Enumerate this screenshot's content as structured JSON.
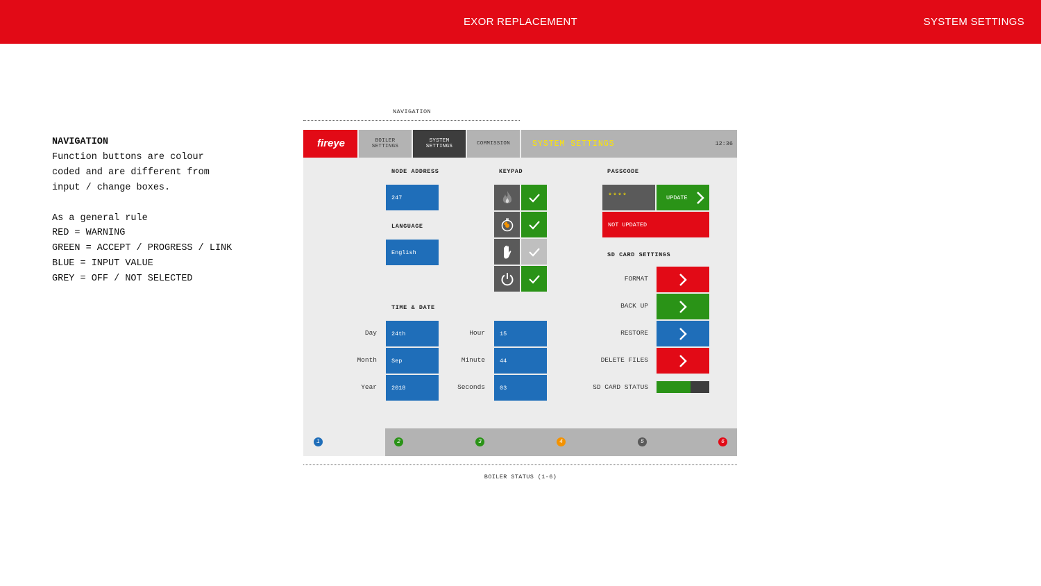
{
  "header": {
    "title": "EXOR REPLACEMENT",
    "section": "SYSTEM SETTINGS"
  },
  "notes": {
    "heading": "NAVIGATION",
    "lines": [
      "Function buttons are colour",
      "coded and are different from",
      "input / change boxes.",
      "",
      "As a general rule",
      "RED = WARNING",
      "GREEN = ACCEPT / PROGRESS / LINK",
      "BLUE = INPUT VALUE",
      "GREY = OFF / NOT SELECTED"
    ]
  },
  "captions": {
    "navigation": "NAVIGATION",
    "boiler_status": "BOILER STATUS (1-6)"
  },
  "screen": {
    "logo": "fireye",
    "nav": {
      "boiler_line1": "BOILER",
      "boiler_line2": "SETTINGS",
      "system_line1": "SYSTEM",
      "system_line2": "SETTINGS",
      "commission": "COMMISSION"
    },
    "title": "SYSTEM SETTINGS",
    "clock": "12:36",
    "node_address": {
      "label": "NODE ADDRESS",
      "value": "247"
    },
    "language": {
      "label": "LANGUAGE",
      "value": "English"
    },
    "keypad": {
      "label": "KEYPAD"
    },
    "passcode": {
      "label": "PASSCODE",
      "value": "****",
      "update": "UPDATE",
      "status": "NOT UPDATED"
    },
    "sd": {
      "label": "SD CARD SETTINGS",
      "format": "FORMAT",
      "backup": "BACK UP",
      "restore": "RESTORE",
      "delete": "DELETE FILES",
      "status": "SD CARD STATUS",
      "status_fill": 0.65
    },
    "time_date": {
      "label": "TIME & DATE",
      "day_label": "Day",
      "day": "24th",
      "month_label": "Month",
      "month": "Sep",
      "year_label": "Year",
      "year": "2018",
      "hour_label": "Hour",
      "hour": "15",
      "minute_label": "Minute",
      "minute": "44",
      "seconds_label": "Seconds",
      "seconds": "03"
    },
    "boilers": [
      {
        "n": "1",
        "color": "#1f6eb9"
      },
      {
        "n": "2",
        "color": "#2a9317"
      },
      {
        "n": "3",
        "color": "#2a9317"
      },
      {
        "n": "4",
        "color": "#f39200"
      },
      {
        "n": "5",
        "color": "#5a5a5a"
      },
      {
        "n": "6",
        "color": "#e20a16"
      }
    ]
  }
}
